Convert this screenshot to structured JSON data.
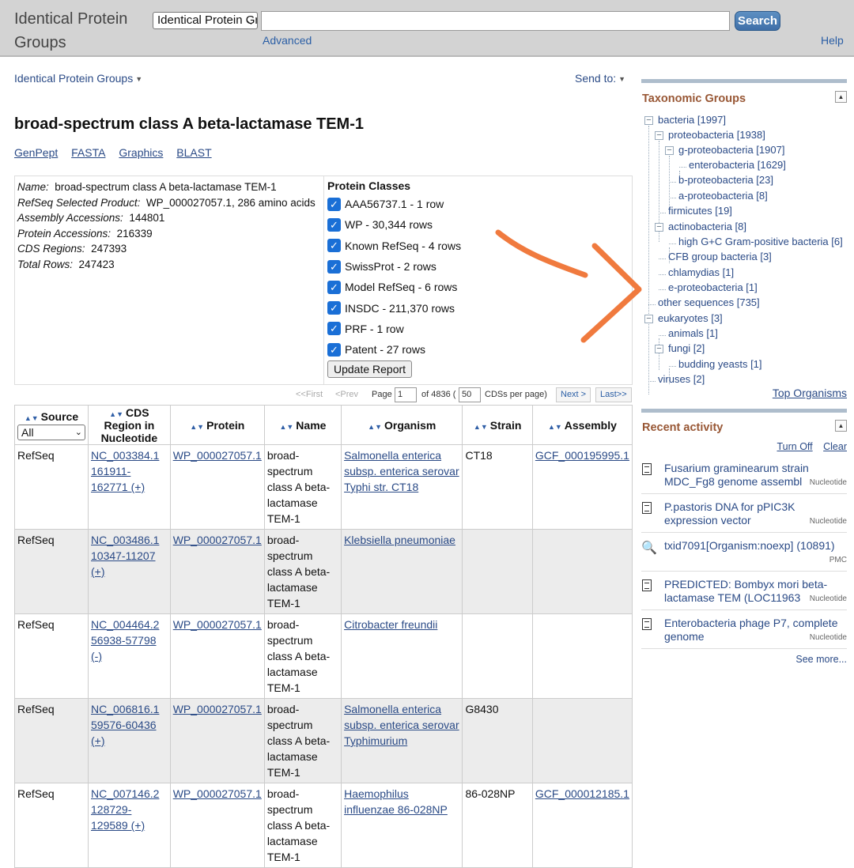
{
  "header": {
    "logo": "Identical Protein Groups",
    "db_select": "Identical Protein Groups",
    "search_value": "",
    "search_button": "Search",
    "advanced": "Advanced",
    "help": "Help"
  },
  "main": {
    "breadcrumb": "Identical Protein Groups",
    "send_to": "Send to:",
    "title": "broad-spectrum class A beta-lactamase TEM-1",
    "links": [
      "GenPept",
      "FASTA",
      "Graphics",
      "BLAST"
    ],
    "summary": {
      "name_label": "Name:",
      "name_value": "broad-spectrum class A beta-lactamase TEM-1",
      "refseq_label": "RefSeq Selected Product:",
      "refseq_value": "WP_000027057.1, 286 amino acids",
      "assembly_label": "Assembly Accessions:",
      "assembly_value": "144801",
      "protein_label": "Protein Accessions:",
      "protein_value": "216339",
      "cds_label": "CDS Regions:",
      "cds_value": "247393",
      "total_label": "Total Rows:",
      "total_value": "247423"
    },
    "protein_classes": {
      "title": "Protein Classes",
      "items": [
        "AAA56737.1 - 1 row",
        "WP - 30,344 rows",
        "Known RefSeq - 4 rows",
        "SwissProt - 2 rows",
        "Model RefSeq - 6 rows",
        "INSDC - 211,370 rows",
        "PRF - 1 row",
        "Patent - 27 rows"
      ],
      "update_button": "Update Report"
    },
    "pager": {
      "first": "<<First",
      "prev": "<Prev",
      "page_label": "Page",
      "page_value": "1",
      "of_label": "of 4836 (",
      "per_page_value": "50",
      "per_page_label": "CDSs per page)",
      "next": "Next >",
      "last": "Last>>"
    },
    "table": {
      "headers": [
        "Source",
        "CDS Region in Nucleotide",
        "Protein",
        "Name",
        "Organism",
        "Strain",
        "Assembly"
      ],
      "source_filter": "All",
      "rows": [
        {
          "source": "RefSeq",
          "cds_acc": "NC_003384.1",
          "cds_range": "161911-162771 (+)",
          "protein": "WP_000027057.1",
          "name": "broad-spectrum class A beta-lactamase TEM-1",
          "organism": "Salmonella enterica subsp. enterica serovar Typhi str. CT18",
          "strain": "CT18",
          "assembly": "GCF_000195995.1"
        },
        {
          "source": "RefSeq",
          "cds_acc": "NC_003486.1",
          "cds_range": "10347-11207 (+)",
          "protein": "WP_000027057.1",
          "name": "broad-spectrum class A beta-lactamase TEM-1",
          "organism": "Klebsiella pneumoniae",
          "strain": "",
          "assembly": ""
        },
        {
          "source": "RefSeq",
          "cds_acc": "NC_004464.2",
          "cds_range": "56938-57798 (-)",
          "protein": "WP_000027057.1",
          "name": "broad-spectrum class A beta-lactamase TEM-1",
          "organism": "Citrobacter freundii",
          "strain": "",
          "assembly": ""
        },
        {
          "source": "RefSeq",
          "cds_acc": "NC_006816.1",
          "cds_range": "59576-60436 (+)",
          "protein": "WP_000027057.1",
          "name": "broad-spectrum class A beta-lactamase TEM-1",
          "organism": "Salmonella enterica subsp. enterica serovar Typhimurium",
          "strain": "G8430",
          "assembly": ""
        },
        {
          "source": "RefSeq",
          "cds_acc": "NC_007146.2",
          "cds_range": "128729-129589 (+)",
          "protein": "WP_000027057.1",
          "name": "broad-spectrum class A beta-lactamase TEM-1",
          "organism": "Haemophilus influenzae 86-028NP",
          "strain": "86-028NP",
          "assembly": "GCF_000012185.1"
        }
      ]
    }
  },
  "sidebar": {
    "taxonomic_title": "Taxonomic Groups",
    "tree": [
      "bacteria [1997]",
      "proteobacteria [1938]",
      "g-proteobacteria [1907]",
      "enterobacteria [1629]",
      "b-proteobacteria [23]",
      "a-proteobacteria [8]",
      "firmicutes [19]",
      "actinobacteria [8]",
      "high G+C Gram-positive bacteria [6]",
      "CFB group bacteria [3]",
      "chlamydias [1]",
      "e-proteobacteria [1]",
      "other sequences [735]",
      "eukaryotes [3]",
      "animals [1]",
      "fungi [2]",
      "budding yeasts [1]",
      "viruses [2]"
    ],
    "top_organisms": "Top Organisms",
    "recent_title": "Recent activity",
    "turn_off": "Turn Off",
    "clear": "Clear",
    "recent": [
      {
        "text": "Fusarium graminearum strain MDC_Fg8 genome assembl",
        "db": "Nucleotide",
        "icon": "document-icon"
      },
      {
        "text": "P.pastoris DNA for pPIC3K expression vector",
        "db": "Nucleotide",
        "icon": "document-icon"
      },
      {
        "text": "txid7091[Organism:noexp] (10891)",
        "db": "PMC",
        "icon": "search-icon"
      },
      {
        "text": "PREDICTED: Bombyx mori beta-lactamase TEM (LOC11963",
        "db": "Nucleotide",
        "icon": "document-icon"
      },
      {
        "text": "Enterobacteria phage P7, complete genome",
        "db": "Nucleotide",
        "icon": "document-icon"
      }
    ],
    "see_more": "See more..."
  },
  "colors": {
    "accent_link": "#2a4a86",
    "panel_title": "#985735",
    "checkbox": "#1a6fd6",
    "annotation_arrow": "#f07a3e"
  }
}
